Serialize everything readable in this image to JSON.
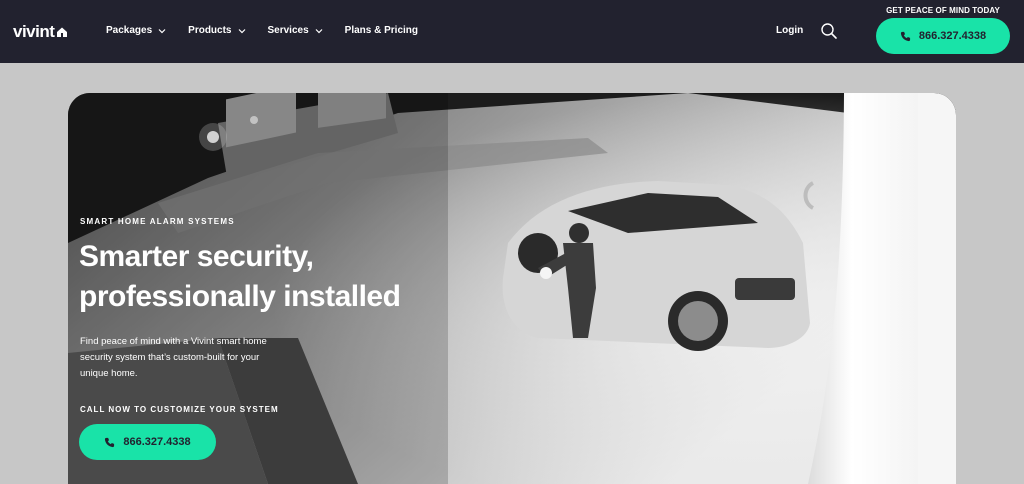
{
  "header": {
    "logo": "vivint",
    "nav": [
      {
        "label": "Packages",
        "has_dropdown": true
      },
      {
        "label": "Products",
        "has_dropdown": true
      },
      {
        "label": "Services",
        "has_dropdown": true
      },
      {
        "label": "Plans & Pricing",
        "has_dropdown": false
      }
    ],
    "login": "Login",
    "tagline": "GET PEACE OF MIND TODAY",
    "phone": "866.327.4338"
  },
  "hero": {
    "eyebrow": "SMART HOME ALARM SYSTEMS",
    "headline_line1": "Smarter security,",
    "headline_line2": "professionally installed",
    "subcopy": "Find peace of mind with a Vivint smart home security system that’s custom-built for your unique home.",
    "cta_label": "CALL NOW TO CUSTOMIZE YOUR SYSTEM",
    "phone": "866.327.4338"
  },
  "colors": {
    "header_bg": "#22222f",
    "accent": "#19e3a8",
    "page_bg": "#c7c7c7"
  },
  "icons": [
    "house-icon",
    "chevron-down-icon",
    "search-icon",
    "phone-icon"
  ]
}
